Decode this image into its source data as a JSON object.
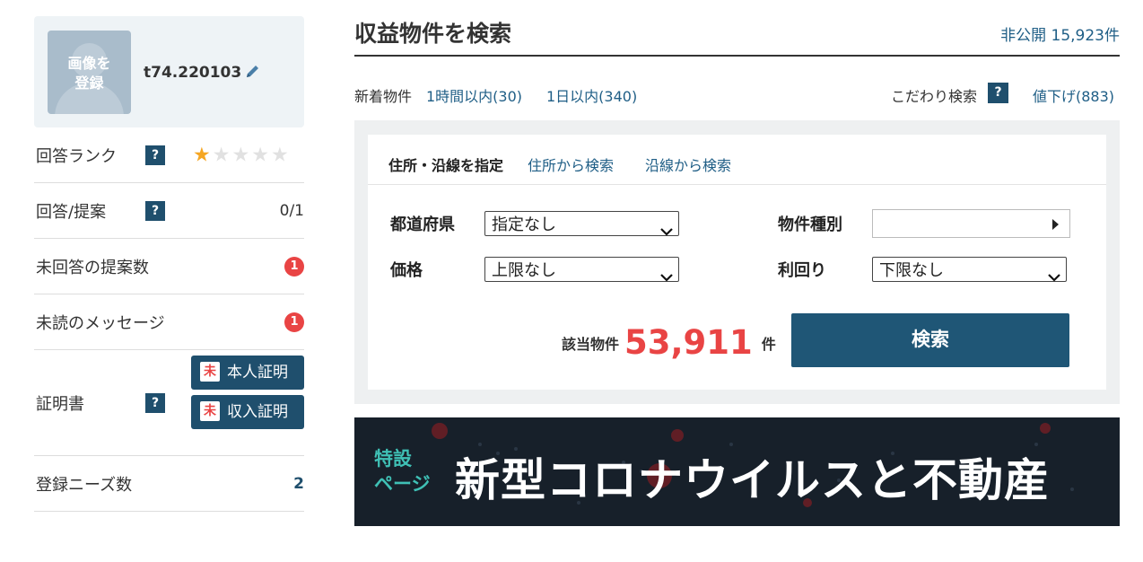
{
  "profile": {
    "avatar_text": "画像を\n登録",
    "username": "t74.220103"
  },
  "sidebar": {
    "rank_label": "回答ランク",
    "rank_stars": 1,
    "rank_max": 5,
    "help_icon": "?",
    "answers_label": "回答/提案",
    "answers_value": "0/1",
    "unanswered_label": "未回答の提案数",
    "unanswered_count": "1",
    "unread_label": "未読のメッセージ",
    "unread_count": "1",
    "cert_label": "証明書",
    "cert_status": "未",
    "cert_id_label": "本人証明",
    "cert_income_label": "収入証明",
    "needs_label": "登録ニーズ数",
    "needs_value": "2"
  },
  "main": {
    "title": "収益物件を検索",
    "private_count": "非公開 15,923件",
    "new_label": "新着物件",
    "new_1h": "1時間以内(30)",
    "new_1d": "1日以内(340)",
    "kodawari": "こだわり検索",
    "price_down": "値下げ(883)"
  },
  "search": {
    "location_label": "住所・沿線を指定",
    "by_address": "住所から検索",
    "by_line": "沿線から検索",
    "pref_label": "都道府県",
    "pref_value": "指定なし",
    "type_label": "物件種別",
    "type_value": "",
    "price_label": "価格",
    "price_value": "上限なし",
    "yield_label": "利回り",
    "yield_value": "下限なし",
    "result_label": "該当物件",
    "result_count": "53,911",
    "result_unit": "件",
    "button": "検索"
  },
  "banner": {
    "tag": "特設\nページ",
    "headline": "新型コロナウイルスと不動産"
  },
  "colors": {
    "navy": "#1f4f6d",
    "link": "#1f5e86",
    "accent_red": "#e94444",
    "star": "#f5a623",
    "banner_teal": "#3fc0b5"
  }
}
